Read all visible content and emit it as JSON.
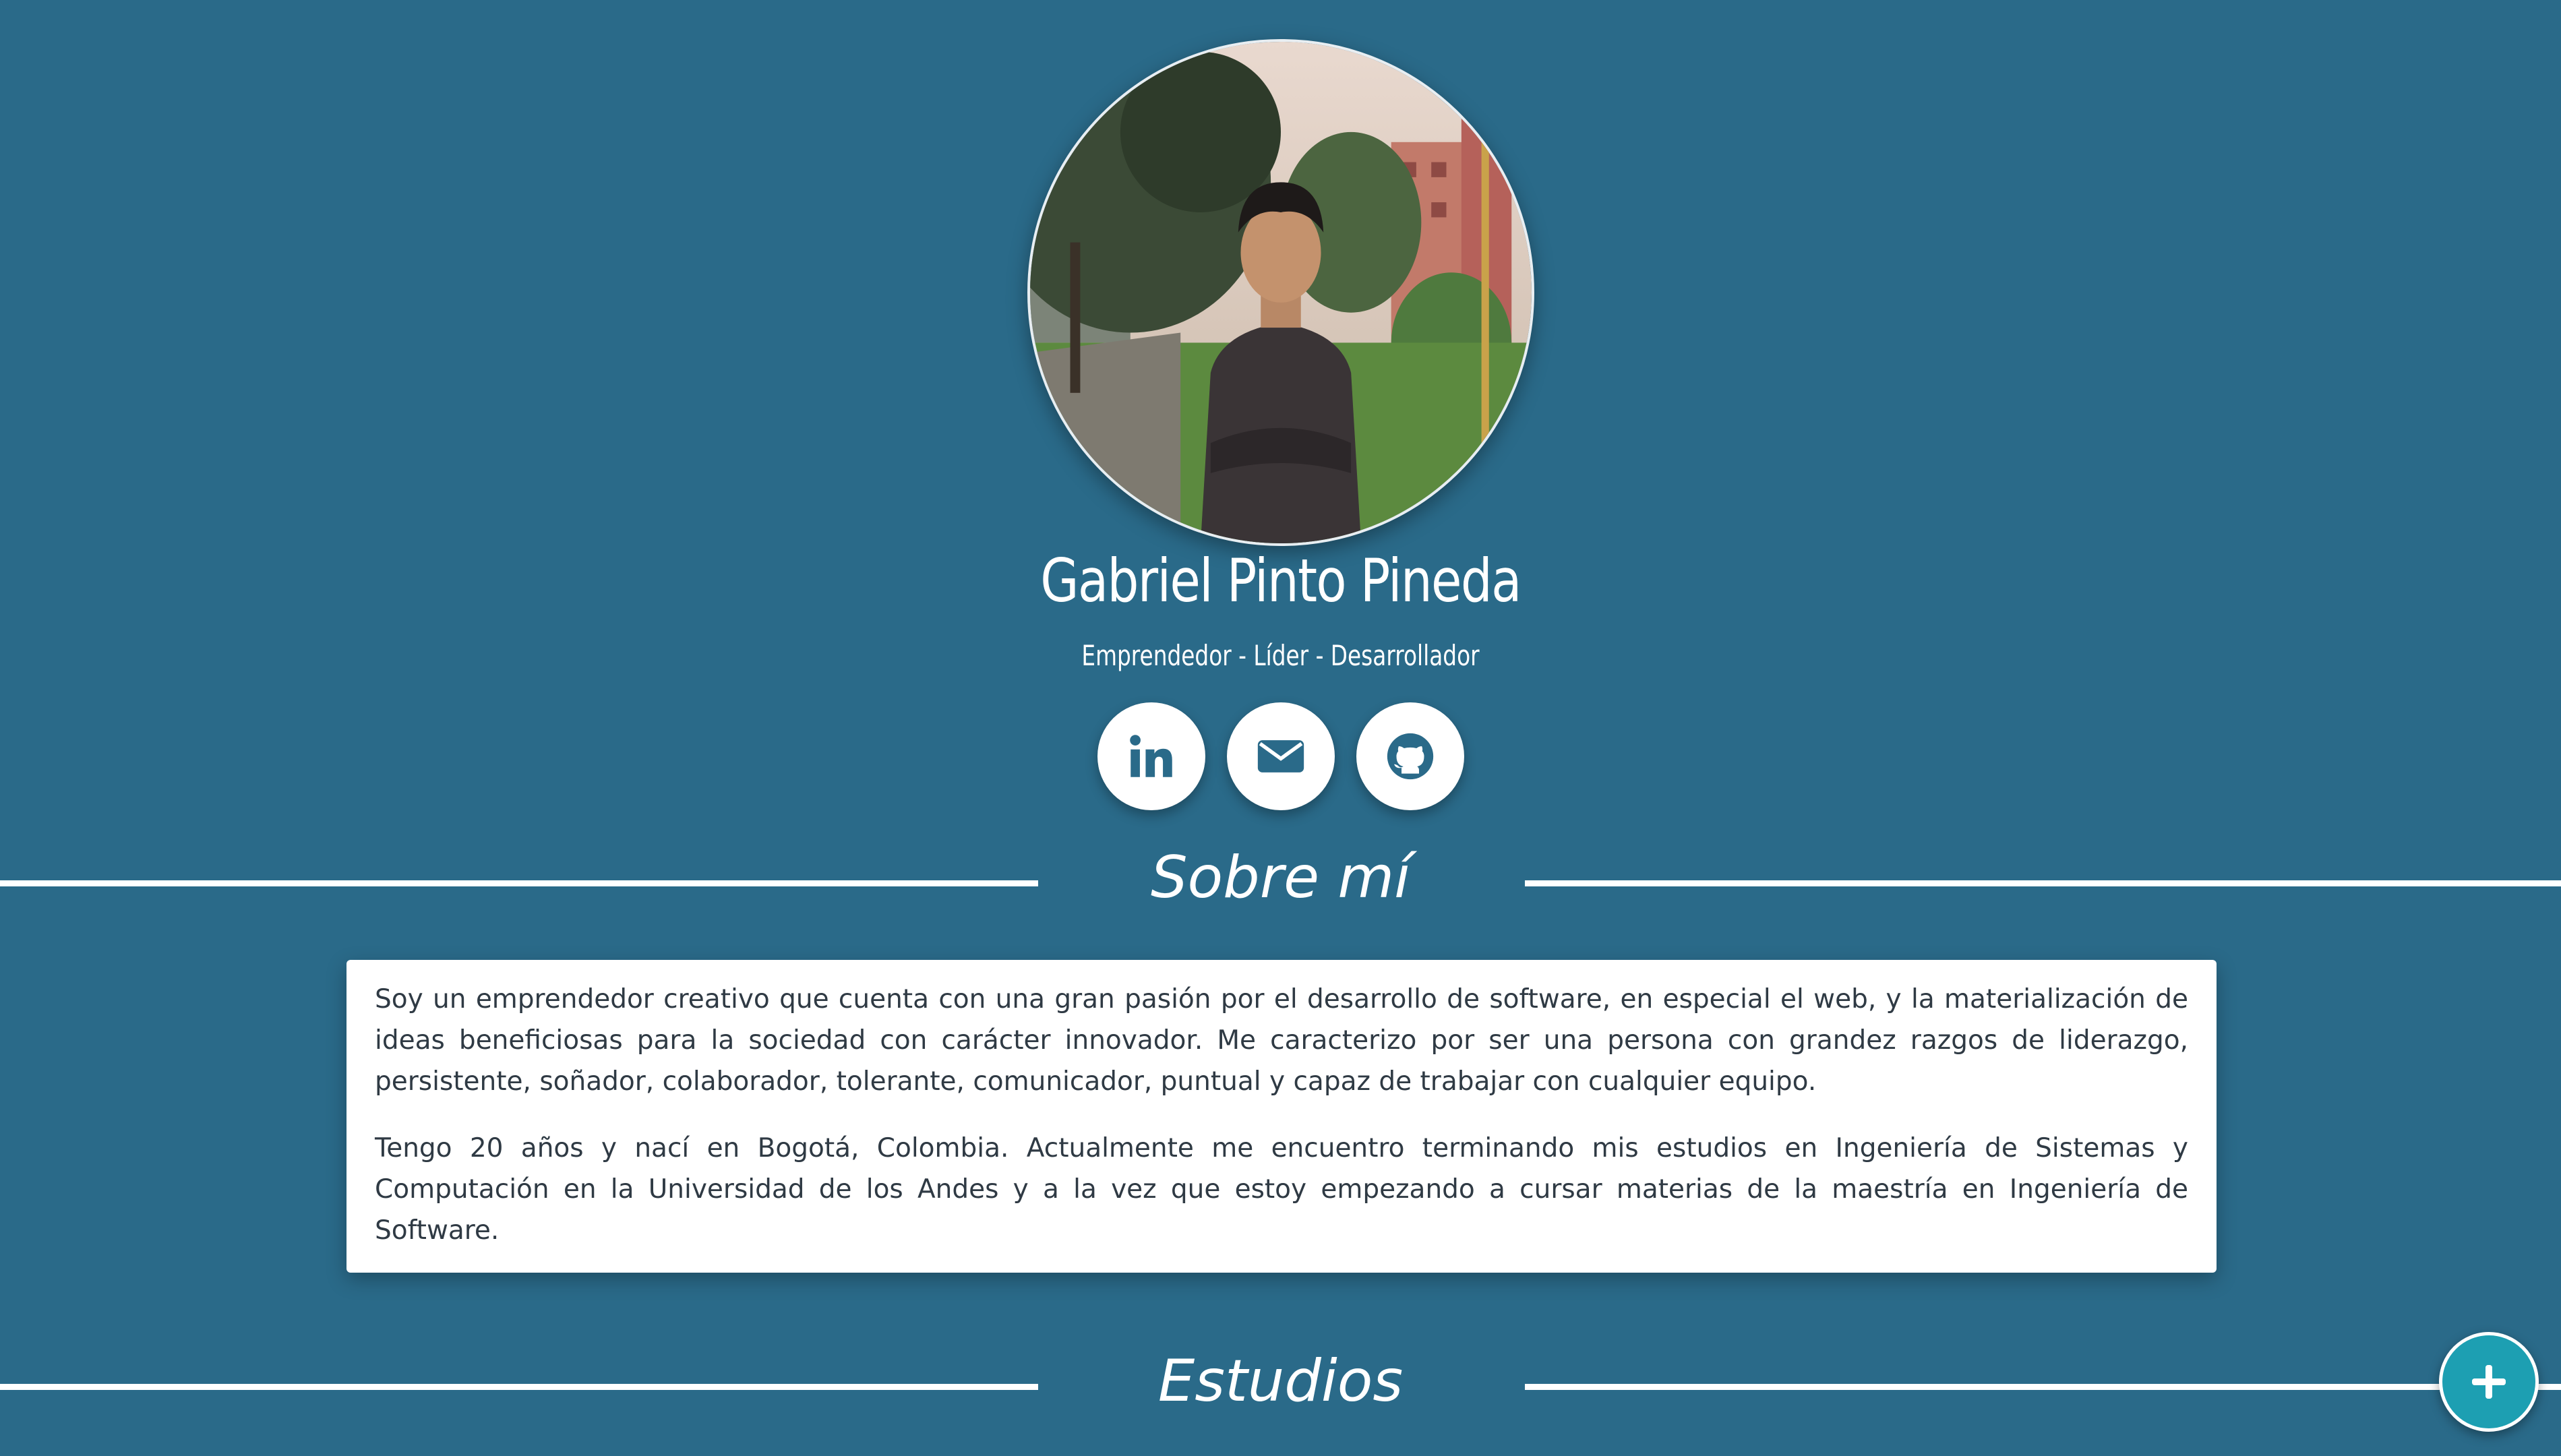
{
  "profile": {
    "name": "Gabriel Pinto Pineda",
    "tagline": "Emprendedor - Líder - Desarrollador",
    "avatar_icon": "profile-photo"
  },
  "socials": [
    {
      "label": "LinkedIn",
      "icon": "linkedin-icon"
    },
    {
      "label": "Email",
      "icon": "envelope-icon"
    },
    {
      "label": "GitHub",
      "icon": "github-icon"
    }
  ],
  "sections": {
    "about_title": "Sobre mí",
    "studies_title": "Estudios"
  },
  "about": {
    "paragraph1": "Soy un emprendedor creativo que cuenta con una gran pasión por el desarrollo de software, en especial el web, y la materialización de ideas beneficiosas para la sociedad con carácter innovador. Me caracterizo por ser una persona con grandez razgos de liderazgo, persistente, soñador, colaborador, tolerante, comunicador, puntual y capaz de trabajar con cualquier equipo.",
    "paragraph2": "Tengo 20 años y nací en Bogotá, Colombia. Actualmente me encuentro terminando mis estudios en Ingeniería de Sistemas y Computación en la Universidad de los Andes y a la vez que estoy empezando a cursar materias de la maestría en Ingeniería de Software."
  },
  "fab": {
    "icon": "plus-icon"
  },
  "colors": {
    "background": "#2a6a89",
    "accent": "#1d9fb2",
    "icon": "#2a6a89",
    "card": "#ffffff"
  }
}
